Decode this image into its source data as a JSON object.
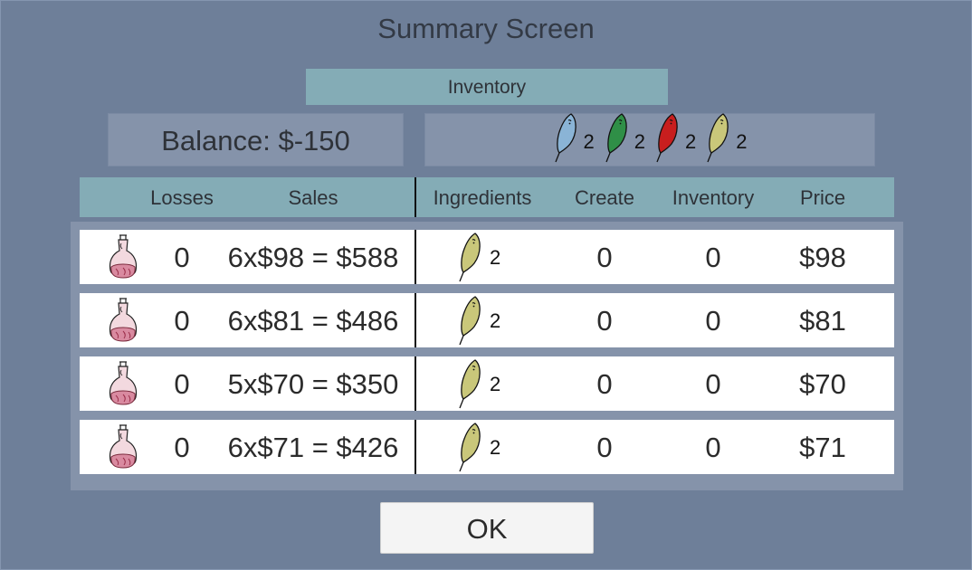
{
  "title": "Summary Screen",
  "inventory_header": "Inventory",
  "balance": "Balance: $-150",
  "feather_inventory": [
    {
      "icon": "blue-feather-icon",
      "color": "#8ab4d6",
      "count": "2"
    },
    {
      "icon": "green-feather-icon",
      "color": "#2f8f47",
      "count": "2"
    },
    {
      "icon": "red-feather-icon",
      "color": "#c81e1e",
      "count": "2"
    },
    {
      "icon": "yellow-feather-icon",
      "color": "#c9c77a",
      "count": "2"
    }
  ],
  "columns": [
    "Losses",
    "Sales",
    "Ingredients",
    "Create",
    "Inventory",
    "Price"
  ],
  "rows": [
    {
      "icon": "potion-icon",
      "losses": "0",
      "sales": "6x$98 = $588",
      "ingredient_icon": "yellow-feather-icon",
      "ingredient_qty": "2",
      "create": "0",
      "inventory": "0",
      "price": "$98"
    },
    {
      "icon": "potion-icon",
      "losses": "0",
      "sales": "6x$81 = $486",
      "ingredient_icon": "yellow-feather-icon",
      "ingredient_qty": "2",
      "create": "0",
      "inventory": "0",
      "price": "$81"
    },
    {
      "icon": "potion-icon",
      "losses": "0",
      "sales": "5x$70 = $350",
      "ingredient_icon": "yellow-feather-icon",
      "ingredient_qty": "2",
      "create": "0",
      "inventory": "0",
      "price": "$70"
    },
    {
      "icon": "potion-icon",
      "losses": "0",
      "sales": "6x$71 = $426",
      "ingredient_icon": "yellow-feather-icon",
      "ingredient_qty": "2",
      "create": "0",
      "inventory": "0",
      "price": "$71"
    }
  ],
  "ok_label": "OK",
  "colors": {
    "background": "#6e7f99",
    "panel": "#8593aa",
    "header_teal": "#84acb6",
    "row_bg": "#ffffff"
  }
}
